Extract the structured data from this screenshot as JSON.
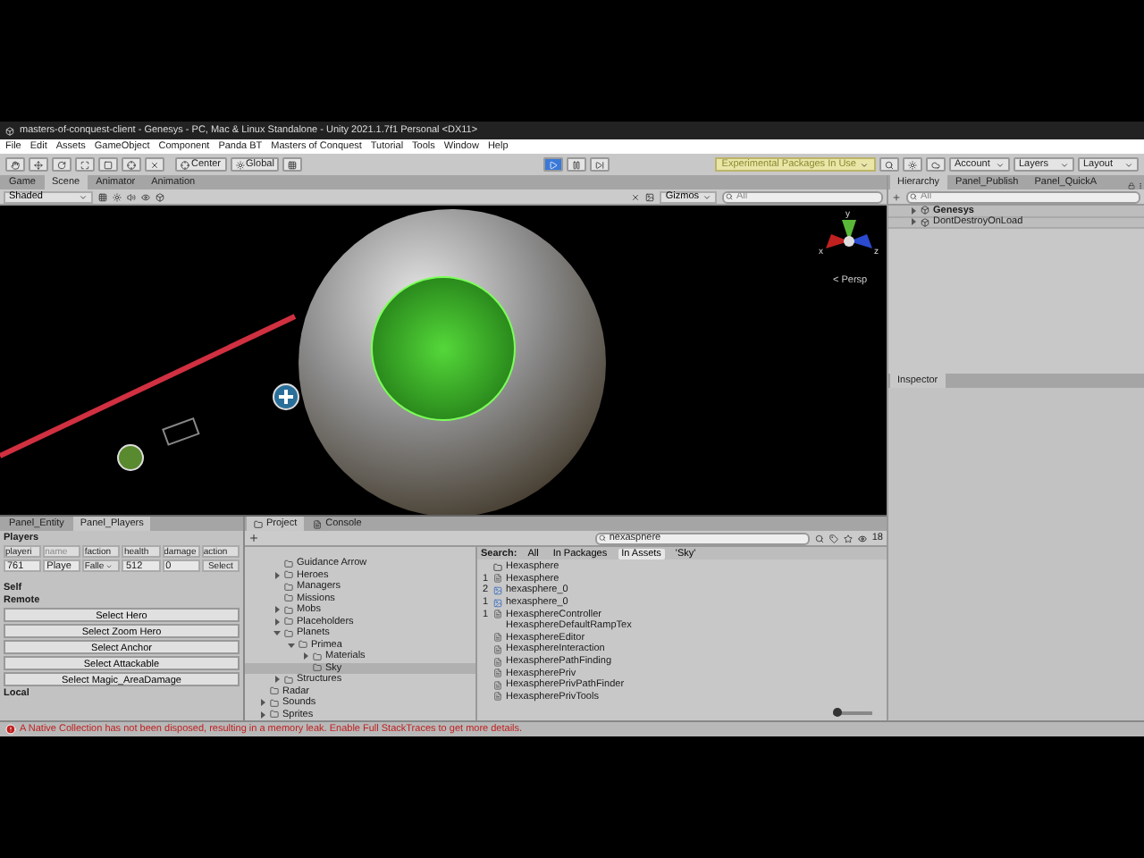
{
  "window": {
    "title": "masters-of-conquest-client - Genesys - PC, Mac & Linux Standalone - Unity 2021.1.7f1 Personal <DX11>"
  },
  "menu": [
    "File",
    "Edit",
    "Assets",
    "GameObject",
    "Component",
    "Panda BT",
    "Masters of Conquest",
    "Tutorial",
    "Tools",
    "Window",
    "Help"
  ],
  "toolbar": {
    "pivot": "Center",
    "space": "Global",
    "playing": true,
    "packages_notice": "Experimental Packages In Use",
    "account": "Account",
    "layers": "Layers",
    "layout": "Layout"
  },
  "scene_tabs": [
    {
      "label": "Game",
      "selected": false
    },
    {
      "label": "Scene",
      "selected": true
    },
    {
      "label": "Animator",
      "selected": false
    },
    {
      "label": "Animation",
      "selected": false
    }
  ],
  "scene_toolbar": {
    "shading": "Shaded",
    "gizmos": "Gizmos",
    "search_placeholder": "All"
  },
  "viewport": {
    "axes": [
      "y",
      "x",
      "z"
    ],
    "projection": "< Persp"
  },
  "hierarchy": {
    "tabs": [
      {
        "label": "Hierarchy",
        "selected": true
      },
      {
        "label": "Panel_Publish",
        "selected": false
      },
      {
        "label": "Panel_QuickA",
        "selected": false
      }
    ],
    "search_placeholder": "All",
    "items": [
      {
        "label": "Genesys",
        "active": true
      },
      {
        "label": "DontDestroyOnLoad",
        "active": false
      }
    ]
  },
  "inspector": {
    "tab": "Inspector"
  },
  "players_panel": {
    "tabs": [
      {
        "label": "Panel_Entity",
        "selected": false
      },
      {
        "label": "Panel_Players",
        "selected": true
      }
    ],
    "heading": "Players",
    "columns": [
      "playeri",
      "name",
      "faction",
      "health",
      "damage",
      "action"
    ],
    "row": {
      "player_id": "761",
      "name": "Playe",
      "faction": "Falle",
      "health": "512",
      "damage": "0",
      "action": "Select"
    },
    "self_label": "Self",
    "remote_label": "Remote",
    "buttons": [
      "Select Hero",
      "Select Zoom Hero",
      "Select Anchor",
      "Select Attackable",
      "Select Magic_AreaDamage"
    ],
    "local_label": "Local"
  },
  "project": {
    "tabs": [
      {
        "label": "Project",
        "selected": true
      },
      {
        "label": "Console",
        "selected": false
      }
    ],
    "search": "hexasphere",
    "result_count": "18",
    "tree": {
      "nested_items": [
        {
          "label": "Guidance Arrow",
          "selected": false
        },
        {
          "label": "Heroes",
          "expanded": false,
          "selected": false
        },
        {
          "label": "Managers",
          "selected": false
        },
        {
          "label": "Missions",
          "selected": false
        },
        {
          "label": "Mobs",
          "expanded": false,
          "selected": false
        },
        {
          "label": "Placeholders",
          "expanded": false,
          "selected": false
        },
        {
          "label": "Planets",
          "expanded": true,
          "selected": false,
          "children": [
            {
              "label": "Primea",
              "expanded": true,
              "selected": false,
              "children": [
                {
                  "label": "Materials",
                  "expanded": false,
                  "selected": false
                },
                {
                  "label": "Sky",
                  "selected": true
                }
              ]
            }
          ]
        },
        {
          "label": "Structures",
          "expanded": false,
          "selected": false
        }
      ],
      "items": [
        {
          "label": "Radar",
          "selected": false
        },
        {
          "label": "Sounds",
          "expanded": false,
          "selected": false
        },
        {
          "label": "Sprites",
          "expanded": false,
          "selected": false
        }
      ]
    },
    "filter_label": "Search:",
    "filters": [
      {
        "label": "All",
        "selected": false
      },
      {
        "label": "In Packages",
        "selected": false
      },
      {
        "label": "In Assets",
        "selected": true
      },
      {
        "label": "'Sky'",
        "selected": false
      }
    ],
    "results": [
      {
        "name": "Hexasphere",
        "kind": "folder"
      },
      {
        "badge": "1",
        "name": "Hexasphere",
        "kind": "script"
      },
      {
        "badge": "2",
        "name": "hexasphere_0",
        "kind": "image"
      },
      {
        "badge": "1",
        "name": "hexasphere_0",
        "kind": "image"
      },
      {
        "badge": "1",
        "name": "HexasphereController",
        "kind": "script"
      },
      {
        "name": "HexasphereDefaultRampTex",
        "kind": "plain"
      },
      {
        "name": "HexasphereEditor",
        "kind": "script"
      },
      {
        "name": "HexasphereInteraction",
        "kind": "script"
      },
      {
        "name": "HexaspherePathFinding",
        "kind": "script"
      },
      {
        "name": "HexaspherePriv",
        "kind": "script"
      },
      {
        "name": "HexaspherePrivPathFinder",
        "kind": "script"
      },
      {
        "name": "HexaspherePrivTools",
        "kind": "script"
      }
    ],
    "icon_size": {
      "level": 0.1
    }
  },
  "status": {
    "message": "A Native Collection has not been disposed, resulting in a memory leak. Enable Full StackTraces to get more details."
  }
}
